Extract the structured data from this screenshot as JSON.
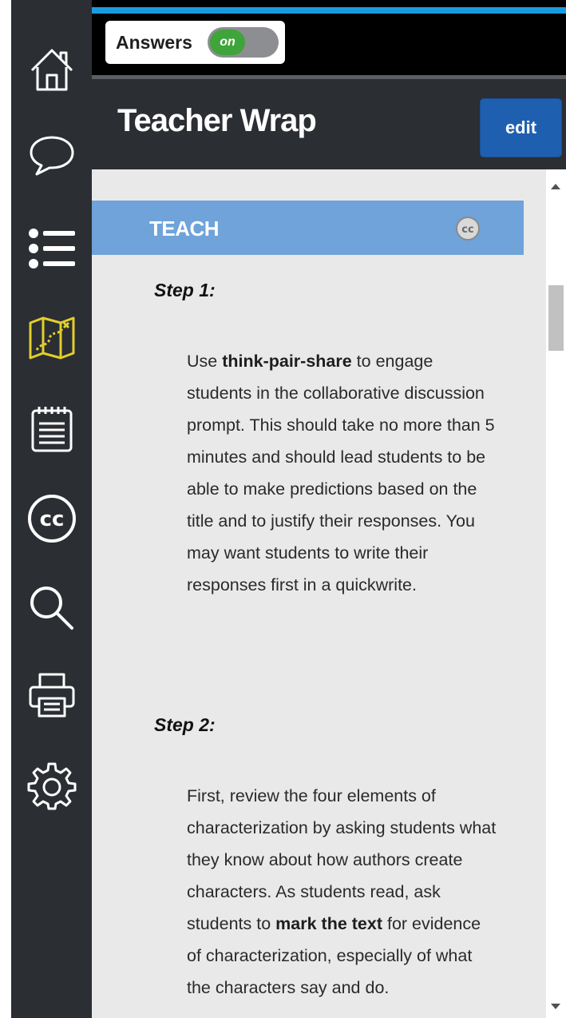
{
  "topbar": {
    "answers_label": "Answers",
    "toggle_state": "on"
  },
  "header": {
    "title": "Teacher Wrap",
    "edit_label": "edit"
  },
  "sidebar": {
    "items": [
      {
        "icon": "home-icon"
      },
      {
        "icon": "chat-bubble-icon"
      },
      {
        "icon": "list-icon"
      },
      {
        "icon": "map-icon",
        "active": true
      },
      {
        "icon": "notepad-icon"
      },
      {
        "icon": "closed-caption-icon"
      },
      {
        "icon": "search-icon"
      },
      {
        "icon": "print-icon"
      },
      {
        "icon": "gear-icon"
      }
    ],
    "active_color": "#e2cf2b"
  },
  "section": {
    "title": "TEACH",
    "icon": "closed-caption-icon"
  },
  "steps": [
    {
      "title": "Step 1:",
      "body_parts": [
        {
          "t": "Use ",
          "b": false
        },
        {
          "t": "think-pair-share",
          "b": true
        },
        {
          "t": " to engage students in the collaborative discussion prompt. This should take no more than 5 minutes and should lead students to be able to make predictions based on the title and to justify their responses. You may want students to write their responses first in a quickwrite.",
          "b": false
        }
      ]
    },
    {
      "title": "Step 2:",
      "body_parts": [
        {
          "t": "First, review the four elements of characterization by asking students what they know about how authors create characters. As students read, ask students to ",
          "b": false
        },
        {
          "t": "mark the text",
          "b": true
        },
        {
          "t": " for evidence of characterization, especially of what the characters say and do.",
          "b": false
        }
      ]
    }
  ],
  "colors": {
    "sidebar_bg": "#2b2e33",
    "accent_blue": "#1a9be0",
    "section_blue": "#6fa3d9",
    "edit_blue": "#1f5fb0",
    "toggle_green": "#3fa43a",
    "content_bg": "#e9e9ea"
  }
}
